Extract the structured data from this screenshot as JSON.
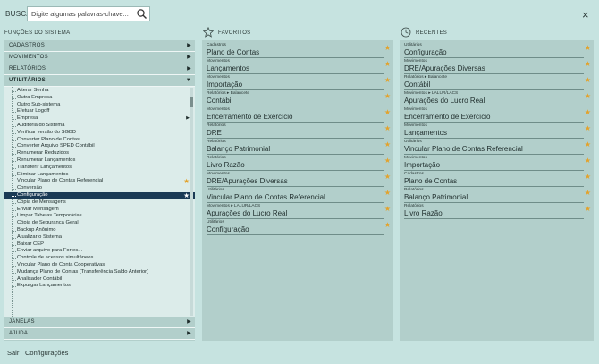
{
  "header": {
    "busca_label": "BUSCA",
    "search_placeholder": "Digite algumas palavras-chave...",
    "close_glyph": "×"
  },
  "sections": {
    "funcoes": "FUNÇÕES DO SISTEMA",
    "favoritos": "FAVORITOS",
    "recentes": "RECENTES"
  },
  "accordion_top": [
    {
      "label": "CADASTROS"
    },
    {
      "label": "MOVIMENTOS"
    },
    {
      "label": "RELATÓRIOS"
    },
    {
      "label": "UTILITÁRIOS",
      "open": true
    }
  ],
  "accordion_bottom": [
    {
      "label": "JANELAS"
    },
    {
      "label": "AJUDA"
    }
  ],
  "utilitarios": [
    {
      "label": "Alterar Senha"
    },
    {
      "label": "Outra Empresa"
    },
    {
      "label": "Outro Sub-sistema"
    },
    {
      "label": "Efetuar Logoff"
    },
    {
      "label": "Empresa",
      "submenu": true
    },
    {
      "label": "Auditoria do Sistema"
    },
    {
      "label": "Verificar versão do SGBD"
    },
    {
      "label": "Converter Plano de Contas"
    },
    {
      "label": "Converter Arquivo SPED Contábil"
    },
    {
      "label": "Renumerar Reduzidos"
    },
    {
      "label": "Renumerar Lançamentos"
    },
    {
      "label": "Transferir Lançamentos"
    },
    {
      "label": "Eliminar Lançamentos"
    },
    {
      "label": "Vincular Plano de Contas Referencial",
      "star": true
    },
    {
      "label": "Conversão"
    },
    {
      "label": "Configuração",
      "star": true,
      "selected": true
    },
    {
      "label": "Cópia de Mensagens"
    },
    {
      "label": "Enviar Mensagem"
    },
    {
      "label": "Limpar Tabelas Temporárias"
    },
    {
      "label": "Cópia de Segurança Geral"
    },
    {
      "label": "Backup Anônimo"
    },
    {
      "label": "Atualizar o Sistema"
    },
    {
      "label": "Baixar CEP"
    },
    {
      "label": "Enviar arquivo para Fortes..."
    },
    {
      "label": "Controle de acessos simultâneos"
    },
    {
      "label": "Vincular Plano de Conta Cooperativas"
    },
    {
      "label": "Mudança Plano de Contas (Transferência Saldo Anterior)"
    },
    {
      "label": "Analisador Contábil"
    },
    {
      "label": "Expurgar Lançamentos"
    }
  ],
  "favoritos": [
    {
      "category": "Cadastros",
      "name": "Plano de Contas"
    },
    {
      "category": "Movimentos",
      "name": "Lançamentos"
    },
    {
      "category": "Movimentos",
      "name": "Importação"
    },
    {
      "category": "Relatórios ▸ Balancete",
      "name": "Contábil"
    },
    {
      "category": "Movimentos",
      "name": "Encerramento de Exercício"
    },
    {
      "category": "Relatórios",
      "name": "DRE"
    },
    {
      "category": "Relatórios",
      "name": "Balanço Patrimonial"
    },
    {
      "category": "Relatórios",
      "name": "Livro Razão"
    },
    {
      "category": "Movimentos",
      "name": "DRE/Apurações Diversas"
    },
    {
      "category": "Utilitários",
      "name": "Vincular Plano de Contas Referencial"
    },
    {
      "category": "Movimentos ▸ LALUR/LACS",
      "name": "Apurações do Lucro Real"
    },
    {
      "category": "Utilitários",
      "name": "Configuração"
    }
  ],
  "recentes": [
    {
      "category": "Utilitários",
      "name": "Configuração"
    },
    {
      "category": "Movimentos",
      "name": "DRE/Apurações Diversas"
    },
    {
      "category": "Relatórios ▸ Balancete",
      "name": "Contábil"
    },
    {
      "category": "Movimentos ▸ LALUR/LACS",
      "name": "Apurações do Lucro Real"
    },
    {
      "category": "Movimentos",
      "name": "Encerramento de Exercício"
    },
    {
      "category": "Movimentos",
      "name": "Lançamentos"
    },
    {
      "category": "Utilitários",
      "name": "Vincular Plano de Contas Referencial"
    },
    {
      "category": "Movimentos",
      "name": "Importação"
    },
    {
      "category": "Cadastros",
      "name": "Plano de Contas"
    },
    {
      "category": "Relatórios",
      "name": "Balanço Patrimonial"
    },
    {
      "category": "Relatórios",
      "name": "Livro Razão"
    }
  ],
  "footer": {
    "sair": "Sair",
    "config": "Configurações"
  },
  "colors": {
    "star": "#e3a22b",
    "selected": "#1a3a55",
    "background": "#c6e3e0",
    "panel": "#b2cfcb"
  },
  "icons": {
    "search": "magnifier-icon",
    "favoritos": "star-outline-icon",
    "recentes": "clock-icon"
  }
}
